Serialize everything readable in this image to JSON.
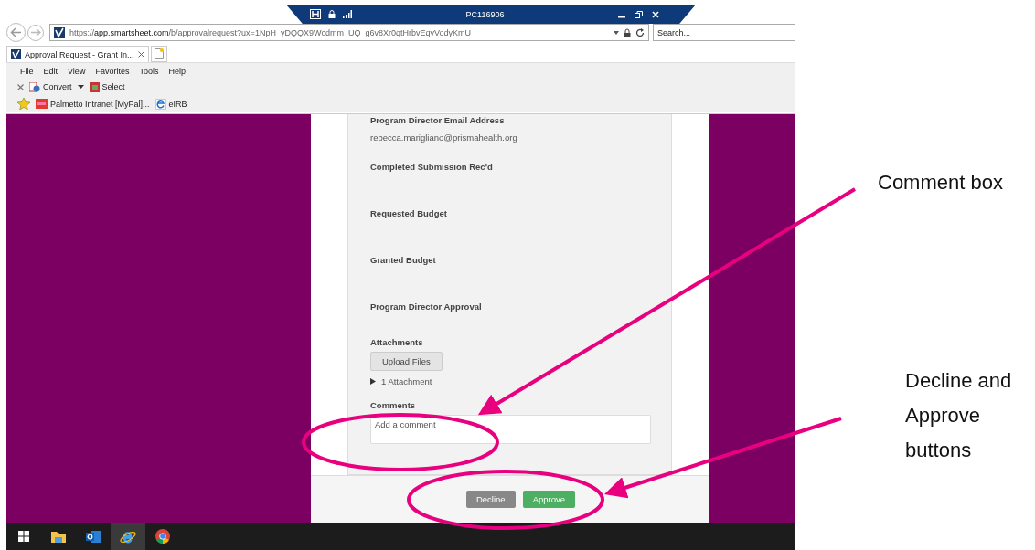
{
  "remote_bar": {
    "title": "PC116906"
  },
  "browser": {
    "address": "https://**app.smartsheet.com**/b/approvalrequest?ux=1NpH_yDQQX9Wcdmm_UQ_g6v8Xr0qtHrbvEqyVodyKmU",
    "search": {
      "placeholder": "Search..."
    },
    "tabs": [
      {
        "label": "Approval Request - Grant In...",
        "selected": true
      }
    ],
    "menu": [
      "File",
      "Edit",
      "View",
      "Favorites",
      "Tools",
      "Help"
    ],
    "command_bar": [
      "Convert",
      "Select"
    ],
    "favorites": [
      "Palmetto Intranet [MyPal]...",
      "eIRB"
    ]
  },
  "form": {
    "fields": [
      {
        "label": "Program Director Email Address",
        "value": "rebecca.marigliano@prismahealth.org"
      },
      {
        "label": "Completed Submission Rec'd"
      },
      {
        "label": "Requested Budget"
      },
      {
        "label": "Granted Budget"
      },
      {
        "label": "Program Director Approval"
      }
    ],
    "attachments": {
      "label": "Attachments",
      "upload_button": "Upload Files",
      "toggle": "1 Attachment",
      "expanded": false
    },
    "comments": {
      "label": "Comments",
      "placeholder": "Add a comment"
    },
    "buttons": [
      {
        "label": "Decline",
        "kind": "secondary"
      },
      {
        "label": "Approve",
        "kind": "primary"
      }
    ]
  },
  "annotations": [
    {
      "text": "Comment box"
    },
    {
      "text": "Decline and Approve buttons"
    }
  ]
}
